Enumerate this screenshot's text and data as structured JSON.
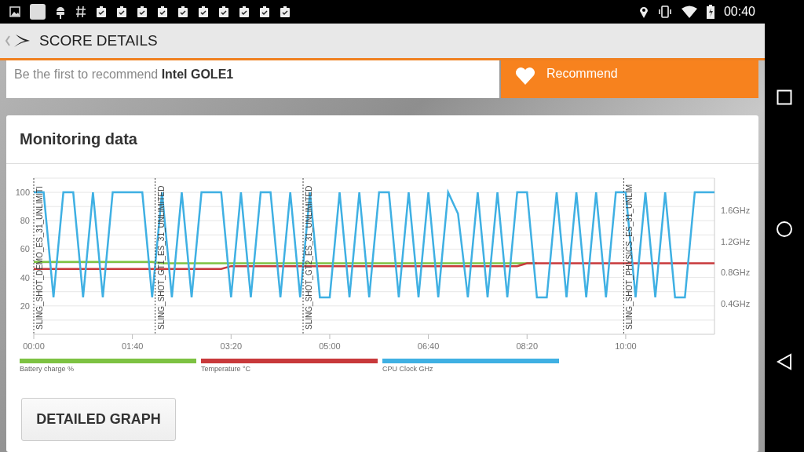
{
  "status_bar": {
    "time": "00:40"
  },
  "app_bar": {
    "title": "SCORE DETAILS"
  },
  "recommend": {
    "text": "Be the first to recommend **Intel GOLE1**",
    "button": "Recommend"
  },
  "monitoring": {
    "title": "Monitoring data",
    "chart_data": {
      "type": "line",
      "xlim": [
        0,
        690
      ],
      "ylim": [
        0,
        110
      ],
      "x": [
        0,
        10,
        20,
        30,
        40,
        50,
        60,
        70,
        80,
        90,
        100,
        110,
        120,
        130,
        140,
        150,
        160,
        170,
        180,
        190,
        200,
        210,
        220,
        230,
        240,
        250,
        260,
        270,
        280,
        290,
        300,
        310,
        320,
        330,
        340,
        350,
        360,
        370,
        380,
        390,
        400,
        410,
        420,
        430,
        440,
        450,
        460,
        470,
        480,
        490,
        500,
        510,
        520,
        530,
        540,
        550,
        560,
        570,
        580,
        590,
        600,
        610,
        620,
        630,
        640,
        650,
        660,
        670,
        680,
        690
      ],
      "series": [
        {
          "name": "Battery charge %",
          "color": "#7dc242",
          "values": [
            51,
            51,
            51,
            51,
            51,
            51,
            51,
            51,
            51,
            51,
            51,
            51,
            51,
            50,
            50,
            50,
            50,
            50,
            50,
            50,
            50,
            50,
            50,
            50,
            50,
            50,
            50,
            50,
            50,
            50,
            50,
            50,
            50,
            50,
            50,
            50,
            50,
            50,
            50,
            50,
            50,
            50,
            50,
            50,
            50,
            50,
            50,
            50,
            50,
            50,
            50,
            50,
            null,
            null,
            null,
            null,
            null,
            null,
            null,
            null,
            null,
            null,
            null,
            null,
            null,
            null,
            null,
            null,
            null,
            null
          ]
        },
        {
          "name": "Temperature °C",
          "color": "#c8393b",
          "values": [
            46,
            46,
            46,
            46,
            46,
            46,
            46,
            46,
            46,
            46,
            46,
            46,
            46,
            46,
            46,
            46,
            46,
            46,
            46,
            46,
            48,
            48,
            48,
            48,
            48,
            48,
            48,
            48,
            48,
            48,
            48,
            48,
            48,
            48,
            48,
            48,
            48,
            48,
            48,
            48,
            48,
            48,
            48,
            48,
            48,
            48,
            48,
            48,
            48,
            48,
            50,
            50,
            50,
            50,
            50,
            50,
            50,
            50,
            50,
            50,
            50,
            50,
            50,
            50,
            50,
            50,
            50,
            50,
            50,
            50
          ]
        },
        {
          "name": "CPU Clock GHz",
          "color": "#3fb0e3",
          "values": [
            100,
            100,
            26,
            100,
            100,
            26,
            100,
            26,
            100,
            100,
            100,
            100,
            26,
            100,
            26,
            100,
            26,
            100,
            100,
            100,
            26,
            100,
            26,
            100,
            100,
            26,
            100,
            26,
            100,
            26,
            26,
            100,
            26,
            100,
            26,
            100,
            100,
            26,
            100,
            26,
            100,
            26,
            100,
            85,
            26,
            100,
            26,
            100,
            26,
            100,
            100,
            26,
            26,
            100,
            26,
            100,
            26,
            100,
            26,
            100,
            100,
            26,
            100,
            26,
            100,
            26,
            26,
            100,
            100,
            100
          ]
        }
      ],
      "xticks": [
        {
          "value": 0,
          "label": "00:00"
        },
        {
          "value": 100,
          "label": "01:40"
        },
        {
          "value": 200,
          "label": "03:20"
        },
        {
          "value": 300,
          "label": "05:00"
        },
        {
          "value": 400,
          "label": "06:40"
        },
        {
          "value": 500,
          "label": "08:20"
        },
        {
          "value": 600,
          "label": "10:00"
        }
      ],
      "yticks": [
        20,
        40,
        60,
        80,
        100
      ],
      "grid": true
    },
    "test_markers": [
      "SLING_SHOT_DEMO_ES_31_UNLIMITI",
      "SLING_SHOT_GT1_ES_31_UNLIMITED",
      "SLING_SHOT_GT2_ES_31_UNLIMITED",
      "SLING_SHOT_PHYSICS_ES_31_UNLIM"
    ],
    "right_axis_labels": [
      "1.6GHz",
      "1.2GHz",
      "0.8GHz",
      "0.4GHz"
    ],
    "button": "DETAILED GRAPH"
  }
}
